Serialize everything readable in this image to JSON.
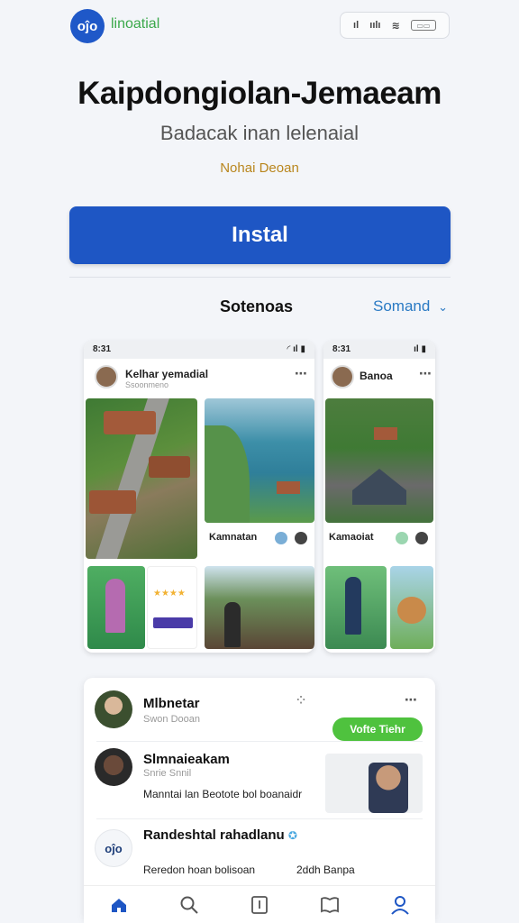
{
  "header": {
    "logo_mark": "oĵo",
    "logo_text": "linoatial",
    "status": {
      "signal": "ıl",
      "bars": "ıılı",
      "wifi": "≋",
      "battery": "▭▭"
    }
  },
  "app": {
    "title": "Kaipdongiolan-Jemaeam",
    "subtitle": "Badacak inan lelenaial",
    "developer": "Nohai Deoan",
    "install_label": "Instal"
  },
  "screenshots": {
    "section_label": "Sotenoas",
    "dropdown_label": "Somand",
    "shot1": {
      "time": "8:31",
      "profile_name": "Kelhar yemadial",
      "profile_sub": "Ssoonmeno",
      "tile_label": "Kamnatan"
    },
    "shot2": {
      "time": "8:31",
      "profile_name": "Banoa",
      "tile_label": "Kamaoiat"
    }
  },
  "feed": {
    "items": [
      {
        "name": "Mlbnetar",
        "sub": "Swon Dooan"
      },
      {
        "name": "Slmnaieakam",
        "sub": "Snrie Snnil",
        "text": "Manntai lan Beotote bol boanaidr"
      },
      {
        "name": "Randeshtal rahadlanu",
        "sub": "Reredon hoan bolisoan",
        "meta": "2ddh Banpa"
      }
    ],
    "follow_label": "Vofte Tiehr"
  },
  "nav": {
    "items": [
      "home-icon",
      "search-icon",
      "library-icon",
      "book-icon",
      "profile-icon"
    ],
    "accent": "#1e56c4"
  }
}
